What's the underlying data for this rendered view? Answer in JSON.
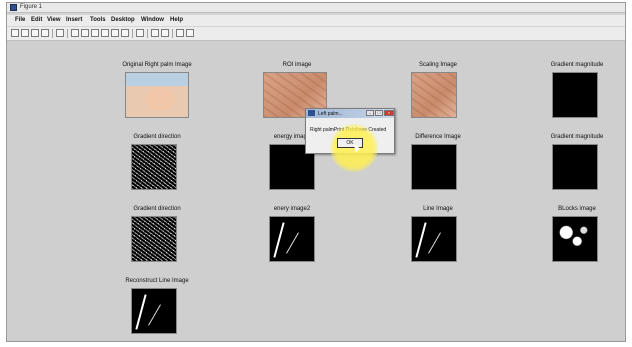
{
  "window": {
    "title": "Figure 1"
  },
  "menu": [
    "File",
    "Edit",
    "View",
    "Insert",
    "Tools",
    "Desktop",
    "Window",
    "Help"
  ],
  "plots": {
    "original_right_palm": "Original Right palm Image",
    "roi": "ROI image",
    "scaling": "Scaling Image",
    "grad_mag_1": "Gradient magnitude",
    "grad_dir_1": "Gradient direction",
    "energy_1": "energy image",
    "difference": "Difference Image",
    "grad_mag_2": "Gradient magnitude",
    "grad_dir_2": "Gradient direction",
    "energy_2": "enery image2",
    "line": "Line Image",
    "blocks": "BLocks image",
    "reconstruct": "Reconstruct Line Image"
  },
  "dialog": {
    "title": "Left palm...",
    "message": "Right palmPrint Database Created",
    "ok": "OK"
  }
}
